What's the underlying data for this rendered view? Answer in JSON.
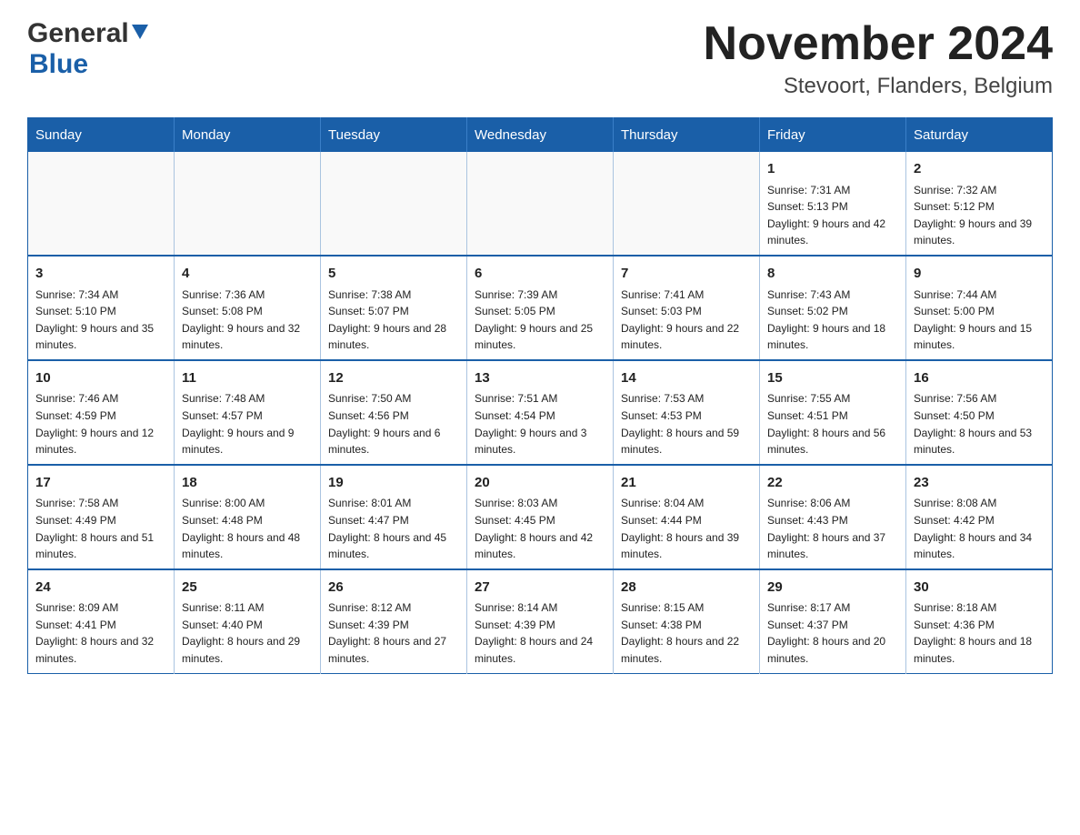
{
  "header": {
    "logo_general": "General",
    "logo_blue": "Blue",
    "month_title": "November 2024",
    "location": "Stevoort, Flanders, Belgium"
  },
  "days_of_week": [
    "Sunday",
    "Monday",
    "Tuesday",
    "Wednesday",
    "Thursday",
    "Friday",
    "Saturday"
  ],
  "weeks": [
    [
      {
        "day": "",
        "sunrise": "",
        "sunset": "",
        "daylight": ""
      },
      {
        "day": "",
        "sunrise": "",
        "sunset": "",
        "daylight": ""
      },
      {
        "day": "",
        "sunrise": "",
        "sunset": "",
        "daylight": ""
      },
      {
        "day": "",
        "sunrise": "",
        "sunset": "",
        "daylight": ""
      },
      {
        "day": "",
        "sunrise": "",
        "sunset": "",
        "daylight": ""
      },
      {
        "day": "1",
        "sunrise": "Sunrise: 7:31 AM",
        "sunset": "Sunset: 5:13 PM",
        "daylight": "Daylight: 9 hours and 42 minutes."
      },
      {
        "day": "2",
        "sunrise": "Sunrise: 7:32 AM",
        "sunset": "Sunset: 5:12 PM",
        "daylight": "Daylight: 9 hours and 39 minutes."
      }
    ],
    [
      {
        "day": "3",
        "sunrise": "Sunrise: 7:34 AM",
        "sunset": "Sunset: 5:10 PM",
        "daylight": "Daylight: 9 hours and 35 minutes."
      },
      {
        "day": "4",
        "sunrise": "Sunrise: 7:36 AM",
        "sunset": "Sunset: 5:08 PM",
        "daylight": "Daylight: 9 hours and 32 minutes."
      },
      {
        "day": "5",
        "sunrise": "Sunrise: 7:38 AM",
        "sunset": "Sunset: 5:07 PM",
        "daylight": "Daylight: 9 hours and 28 minutes."
      },
      {
        "day": "6",
        "sunrise": "Sunrise: 7:39 AM",
        "sunset": "Sunset: 5:05 PM",
        "daylight": "Daylight: 9 hours and 25 minutes."
      },
      {
        "day": "7",
        "sunrise": "Sunrise: 7:41 AM",
        "sunset": "Sunset: 5:03 PM",
        "daylight": "Daylight: 9 hours and 22 minutes."
      },
      {
        "day": "8",
        "sunrise": "Sunrise: 7:43 AM",
        "sunset": "Sunset: 5:02 PM",
        "daylight": "Daylight: 9 hours and 18 minutes."
      },
      {
        "day": "9",
        "sunrise": "Sunrise: 7:44 AM",
        "sunset": "Sunset: 5:00 PM",
        "daylight": "Daylight: 9 hours and 15 minutes."
      }
    ],
    [
      {
        "day": "10",
        "sunrise": "Sunrise: 7:46 AM",
        "sunset": "Sunset: 4:59 PM",
        "daylight": "Daylight: 9 hours and 12 minutes."
      },
      {
        "day": "11",
        "sunrise": "Sunrise: 7:48 AM",
        "sunset": "Sunset: 4:57 PM",
        "daylight": "Daylight: 9 hours and 9 minutes."
      },
      {
        "day": "12",
        "sunrise": "Sunrise: 7:50 AM",
        "sunset": "Sunset: 4:56 PM",
        "daylight": "Daylight: 9 hours and 6 minutes."
      },
      {
        "day": "13",
        "sunrise": "Sunrise: 7:51 AM",
        "sunset": "Sunset: 4:54 PM",
        "daylight": "Daylight: 9 hours and 3 minutes."
      },
      {
        "day": "14",
        "sunrise": "Sunrise: 7:53 AM",
        "sunset": "Sunset: 4:53 PM",
        "daylight": "Daylight: 8 hours and 59 minutes."
      },
      {
        "day": "15",
        "sunrise": "Sunrise: 7:55 AM",
        "sunset": "Sunset: 4:51 PM",
        "daylight": "Daylight: 8 hours and 56 minutes."
      },
      {
        "day": "16",
        "sunrise": "Sunrise: 7:56 AM",
        "sunset": "Sunset: 4:50 PM",
        "daylight": "Daylight: 8 hours and 53 minutes."
      }
    ],
    [
      {
        "day": "17",
        "sunrise": "Sunrise: 7:58 AM",
        "sunset": "Sunset: 4:49 PM",
        "daylight": "Daylight: 8 hours and 51 minutes."
      },
      {
        "day": "18",
        "sunrise": "Sunrise: 8:00 AM",
        "sunset": "Sunset: 4:48 PM",
        "daylight": "Daylight: 8 hours and 48 minutes."
      },
      {
        "day": "19",
        "sunrise": "Sunrise: 8:01 AM",
        "sunset": "Sunset: 4:47 PM",
        "daylight": "Daylight: 8 hours and 45 minutes."
      },
      {
        "day": "20",
        "sunrise": "Sunrise: 8:03 AM",
        "sunset": "Sunset: 4:45 PM",
        "daylight": "Daylight: 8 hours and 42 minutes."
      },
      {
        "day": "21",
        "sunrise": "Sunrise: 8:04 AM",
        "sunset": "Sunset: 4:44 PM",
        "daylight": "Daylight: 8 hours and 39 minutes."
      },
      {
        "day": "22",
        "sunrise": "Sunrise: 8:06 AM",
        "sunset": "Sunset: 4:43 PM",
        "daylight": "Daylight: 8 hours and 37 minutes."
      },
      {
        "day": "23",
        "sunrise": "Sunrise: 8:08 AM",
        "sunset": "Sunset: 4:42 PM",
        "daylight": "Daylight: 8 hours and 34 minutes."
      }
    ],
    [
      {
        "day": "24",
        "sunrise": "Sunrise: 8:09 AM",
        "sunset": "Sunset: 4:41 PM",
        "daylight": "Daylight: 8 hours and 32 minutes."
      },
      {
        "day": "25",
        "sunrise": "Sunrise: 8:11 AM",
        "sunset": "Sunset: 4:40 PM",
        "daylight": "Daylight: 8 hours and 29 minutes."
      },
      {
        "day": "26",
        "sunrise": "Sunrise: 8:12 AM",
        "sunset": "Sunset: 4:39 PM",
        "daylight": "Daylight: 8 hours and 27 minutes."
      },
      {
        "day": "27",
        "sunrise": "Sunrise: 8:14 AM",
        "sunset": "Sunset: 4:39 PM",
        "daylight": "Daylight: 8 hours and 24 minutes."
      },
      {
        "day": "28",
        "sunrise": "Sunrise: 8:15 AM",
        "sunset": "Sunset: 4:38 PM",
        "daylight": "Daylight: 8 hours and 22 minutes."
      },
      {
        "day": "29",
        "sunrise": "Sunrise: 8:17 AM",
        "sunset": "Sunset: 4:37 PM",
        "daylight": "Daylight: 8 hours and 20 minutes."
      },
      {
        "day": "30",
        "sunrise": "Sunrise: 8:18 AM",
        "sunset": "Sunset: 4:36 PM",
        "daylight": "Daylight: 8 hours and 18 minutes."
      }
    ]
  ]
}
